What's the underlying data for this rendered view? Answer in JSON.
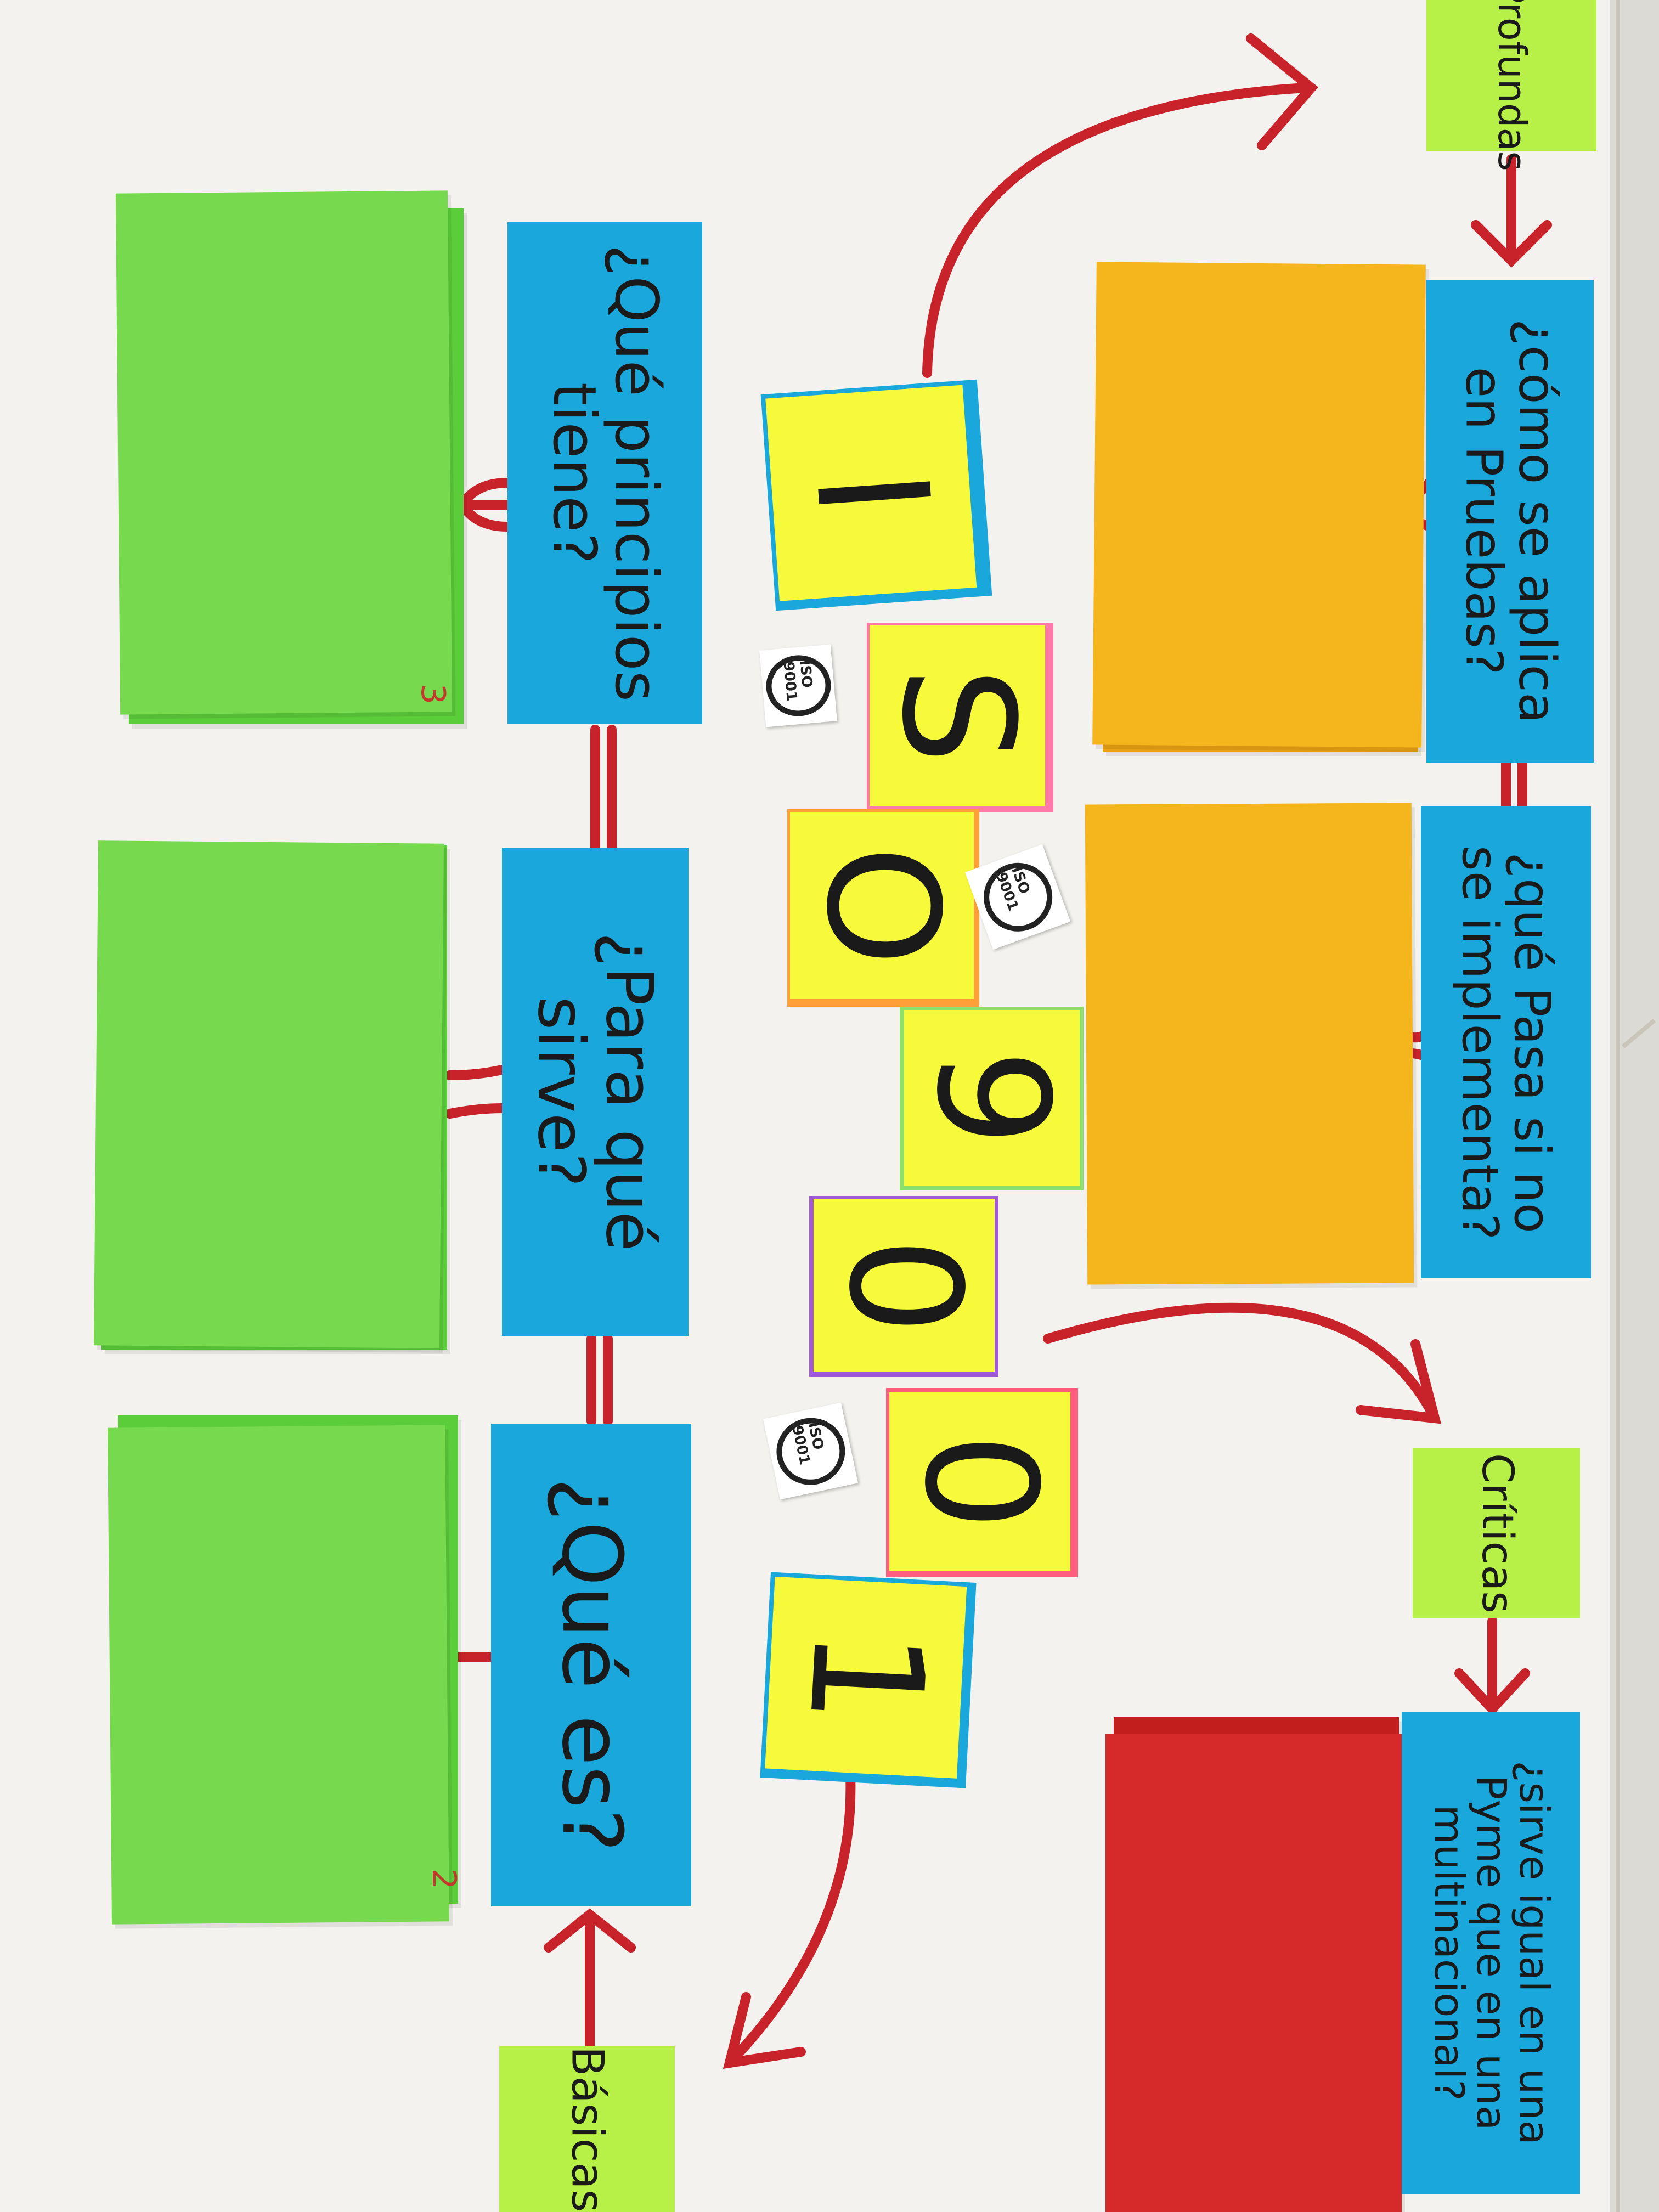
{
  "questions": {
    "que_es": "¿Qué es?",
    "para_que_sirve": "¿Para qué\nsirve?",
    "que_principios": "¿Qué principios\ntiene?",
    "como_se_aplica": "¿cómo se aplica\nen Pruebas?",
    "que_pasa": "¿qué Pasa si no\nse implementa?",
    "sirve_igual": "¿sirve igual en una\nPyme que en una\nmultinacional?"
  },
  "categories": {
    "basicas": "Básicas",
    "criticas": "Críticas",
    "profundas": "Profundas"
  },
  "title_tiles": [
    "I",
    "S",
    "O",
    "9",
    "0",
    "0",
    "1"
  ],
  "badges": [
    "ISO 9001",
    "ISO 9001",
    "ISO 9001"
  ],
  "number_marks": [
    "3",
    "2"
  ],
  "colors": {
    "question_cards": "#1aa7dc",
    "category_cards": "#b7f147",
    "left_sheets": "#76d94e",
    "right_sheets": "#f5b51d",
    "bottom_right_sheet": "#d62a2a",
    "letter_tiles": "#f7fa3a",
    "arrows": "#c8232b"
  }
}
